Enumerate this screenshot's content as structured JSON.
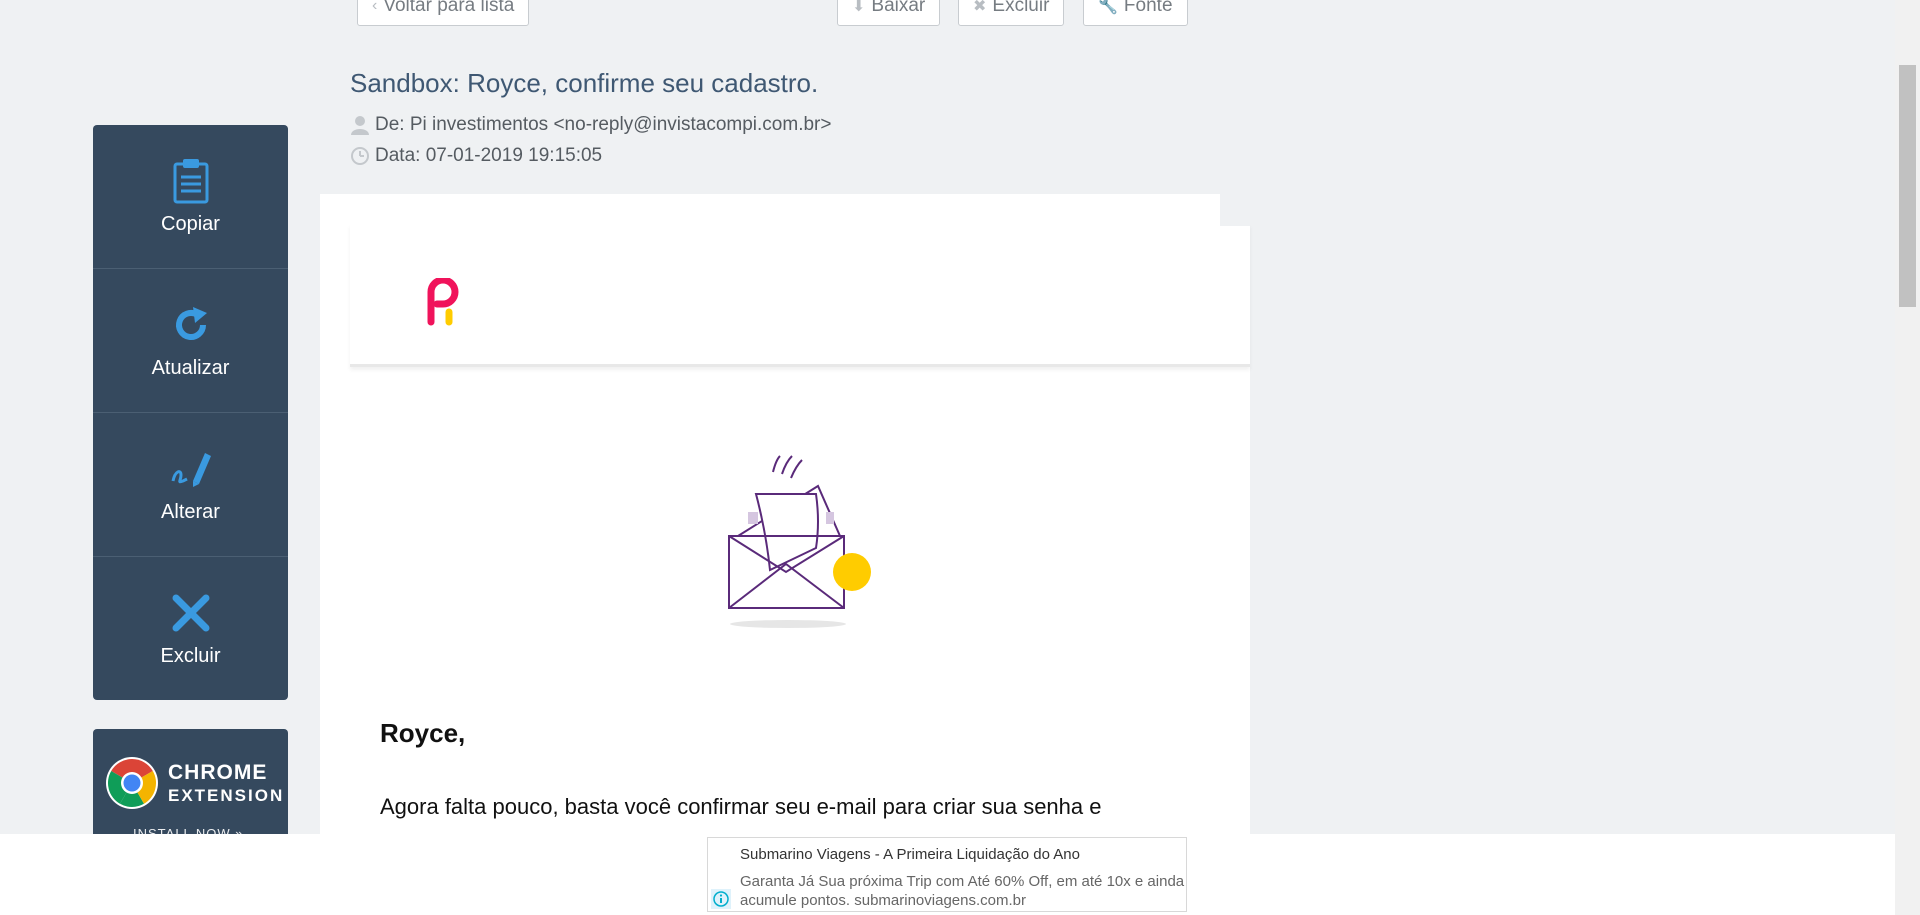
{
  "sidebar": {
    "items": [
      {
        "label": "Copiar",
        "icon": "clipboard-icon"
      },
      {
        "label": "Atualizar",
        "icon": "refresh-icon"
      },
      {
        "label": "Alterar",
        "icon": "edit-pen-icon"
      },
      {
        "label": "Excluir",
        "icon": "close-x-icon"
      }
    ]
  },
  "chrome_extension": {
    "line1": "CHROME",
    "line2": "EXTENSION",
    "line3": "INSTALL NOW »"
  },
  "toolbar": {
    "back_label": "Voltar para lista",
    "download_label": "Baixar",
    "delete_label": "Excluir",
    "source_label": "Fonte"
  },
  "mail": {
    "subject": "Sandbox: Royce, confirme seu cadastro.",
    "from": "De: Pi investimentos <no-reply@invistacompi.com.br>",
    "date": "Data: 07-01-2019 19:15:05",
    "greeting": "Royce,",
    "body": "Agora falta pouco, basta você confirmar seu e-mail para criar sua senha e"
  },
  "ad": {
    "title": "Submarino Viagens - A Primeira Liquidação do Ano",
    "description": "Garanta Já Sua próxima Trip com Até 60% Off, em até 10x e ainda acumule pontos. submarinoviagens.com.br"
  },
  "colors": {
    "sidebar_bg": "#35495e",
    "icon_blue": "#3a9ae0",
    "subject_color": "#3f5873",
    "brand_pink": "#f0135b",
    "brand_yellow": "#ffcc00"
  }
}
